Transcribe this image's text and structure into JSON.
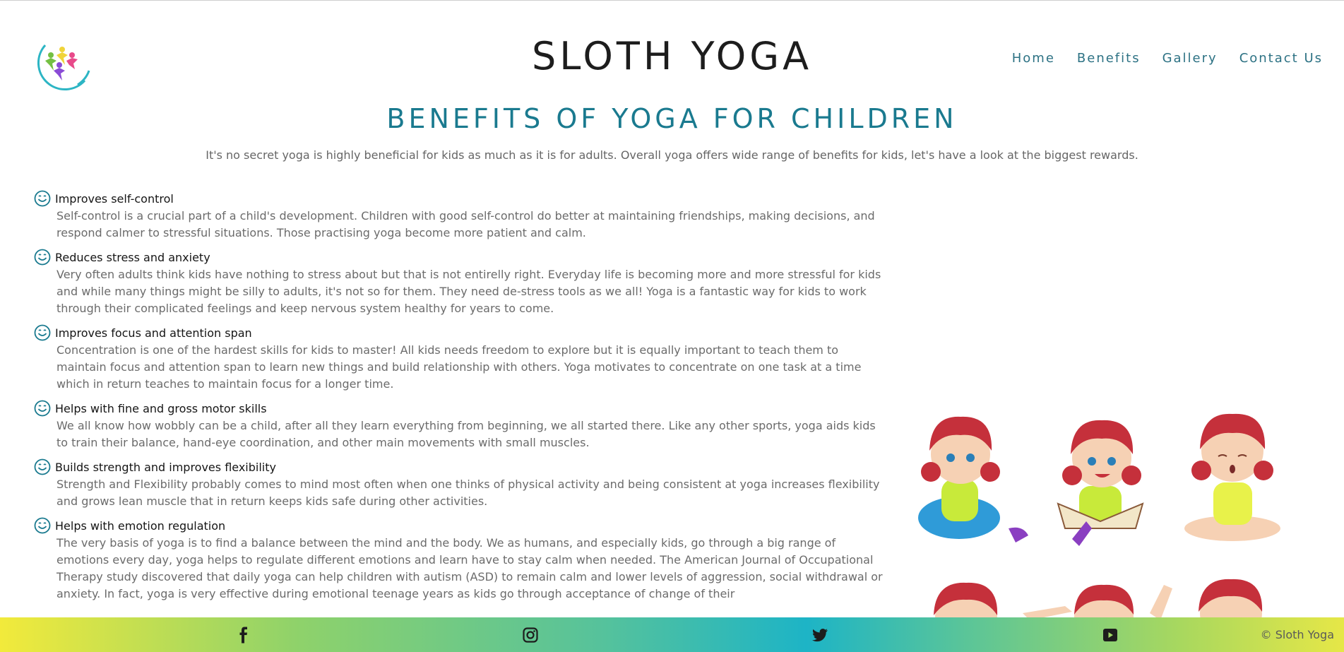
{
  "header": {
    "title": "SLOTH YOGA",
    "nav": [
      "Home",
      "Benefits",
      "Gallery",
      "Contact Us"
    ]
  },
  "main": {
    "heading": "BENEFITS OF YOGA FOR CHILDREN",
    "intro": "It's no secret yoga is highly beneficial for kids as much as it is for adults. Overall yoga offers wide range of benefits for kids, let's have a look at the biggest rewards.",
    "benefits": [
      {
        "title": "Improves self-control",
        "text": "Self-control is a crucial part of a child's development. Children with good self-control do better at maintaining friendships, making decisions, and respond calmer to stressful situations. Those practising yoga become more patient and calm."
      },
      {
        "title": "Reduces stress and anxiety",
        "text": "Very often adults think kids have nothing to stress about but that is not entirelly right. Everyday life is becoming more and more stressful for kids and while many things might be silly to adults, it's not so for them. They need de-stress tools as we all! Yoga is a fantastic way for kids to work through their complicated feelings and keep nervous system healthy for years to come."
      },
      {
        "title": "Improves focus and attention span",
        "text": "Concentration is one of the hardest skills for kids to master! All kids needs freedom to explore but it is equally important to teach them to maintain focus and attention span to learn new things and build relationship with others. Yoga motivates to concentrate on one task at a time which in return teaches to maintain focus for a longer time."
      },
      {
        "title": "Helps with fine and gross motor skills",
        "text": "We all know how wobbly can be a child, after all they learn everything from beginning, we all started there. Like any other sports, yoga aids kids to train their balance, hand-eye coordination, and other main movements with small muscles."
      },
      {
        "title": "Builds strength and improves flexibility",
        "text": "Strength and Flexibility probably comes to mind most often when one thinks of physical activity and being consistent at yoga increases flexibility and grows lean muscle that in return keeps kids safe during other activities."
      },
      {
        "title": "Helps with emotion regulation",
        "text": "The very basis of yoga is to find a balance between the mind and the body. We as humans, and especially kids, go through a big range of emotions every day, yoga helps to regulate different emotions and learn have to stay calm when needed. The American Journal of Occupational Therapy study discovered that daily yoga can help children with autism (ASD) to remain calm and lower levels of aggression, social withdrawal or anxiety. In fact, yoga is very effective during emotional teenage years as kids go through acceptance of change of their"
      }
    ]
  },
  "footer": {
    "icons": [
      "facebook-icon",
      "instagram-icon",
      "twitter-icon",
      "youtube-icon"
    ],
    "copyright": "© Sloth Yoga"
  },
  "colors": {
    "accent": "#1a7a8f",
    "nav": "#2d7284",
    "footer_gradient": [
      "#f2ea3b",
      "#55c29c",
      "#1db4c6",
      "#e6e747"
    ]
  }
}
